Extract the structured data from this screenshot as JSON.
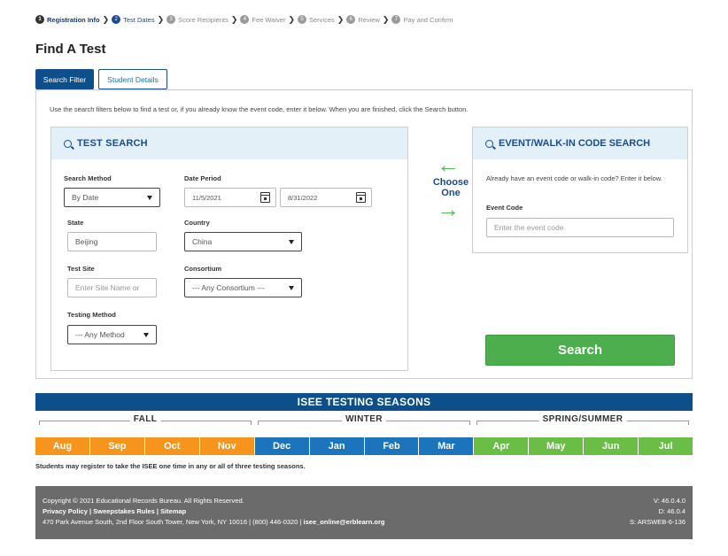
{
  "steps": [
    {
      "num": "1",
      "label": "Registration Info"
    },
    {
      "num": "2",
      "label": "Test Dates"
    },
    {
      "num": "3",
      "label": "Score Recipients"
    },
    {
      "num": "4",
      "label": "Fee Waiver"
    },
    {
      "num": "5",
      "label": "Services"
    },
    {
      "num": "6",
      "label": "Review"
    },
    {
      "num": "7",
      "label": "Pay and Confirm"
    }
  ],
  "page_title": "Find A Test",
  "tabs": {
    "search_filter": "Search Filter",
    "student_details": "Student Details"
  },
  "instructions": "Use the search filters below to find a test or, if you already know the event code, enter it below. When you are finished, click the Search button.",
  "test_search": {
    "title": "TEST SEARCH",
    "search_method": {
      "label": "Search Method",
      "value": "By Date"
    },
    "date_period": {
      "label": "Date Period",
      "from": "11/5/2021",
      "to": "8/31/2022"
    },
    "state": {
      "label": "State",
      "value": "Beijing"
    },
    "country": {
      "label": "Country",
      "value": "China"
    },
    "test_site": {
      "label": "Test Site",
      "placeholder": "Enter Site Name or"
    },
    "consortium": {
      "label": "Consortium",
      "value": "--- Any Consortium ---"
    },
    "testing_method": {
      "label": "Testing Method",
      "value": "--- Any Method"
    }
  },
  "choose": {
    "line1": "Choose",
    "line2": "One"
  },
  "event_search": {
    "title": "EVENT/WALK-IN CODE SEARCH",
    "text": "Already have an event code or walk-in code? Enter it below.",
    "code_label": "Event Code",
    "placeholder": "Enter the event code"
  },
  "search_button": "Search",
  "seasons": {
    "title": "ISEE TESTING SEASONS",
    "fall": "FALL",
    "winter": "WINTER",
    "spring": "SPRING/SUMMER",
    "months": [
      {
        "label": "Aug",
        "color": "#f7941d"
      },
      {
        "label": "Sep",
        "color": "#f7941d"
      },
      {
        "label": "Oct",
        "color": "#f7941d"
      },
      {
        "label": "Nov",
        "color": "#f7941d"
      },
      {
        "label": "Dec",
        "color": "#1c75bc"
      },
      {
        "label": "Jan",
        "color": "#1c75bc"
      },
      {
        "label": "Feb",
        "color": "#1c75bc"
      },
      {
        "label": "Mar",
        "color": "#1c75bc"
      },
      {
        "label": "Apr",
        "color": "#6abd45"
      },
      {
        "label": "May",
        "color": "#6abd45"
      },
      {
        "label": "Jun",
        "color": "#6abd45"
      },
      {
        "label": "Jul",
        "color": "#6abd45"
      }
    ],
    "note": "Students may register to take the ISEE one time in any or all of three testing seasons."
  },
  "footer": {
    "copyright": "Copyright © 2021 Educational Records Bureau. All Rights Reserved.",
    "privacy": "Privacy Policy",
    "sweepstakes": "Sweepstakes Rules",
    "sitemap": "Sitemap",
    "address": "470 Park Avenue South, 2nd Floor South Tower, New York, NY 10016 | (800) 446-0320 | ",
    "email": "isee_online@erblearn.org",
    "version": "V: 46.0.4.0",
    "db": "D: 46.0.4",
    "server": "S: ARSWEB-6-136"
  }
}
